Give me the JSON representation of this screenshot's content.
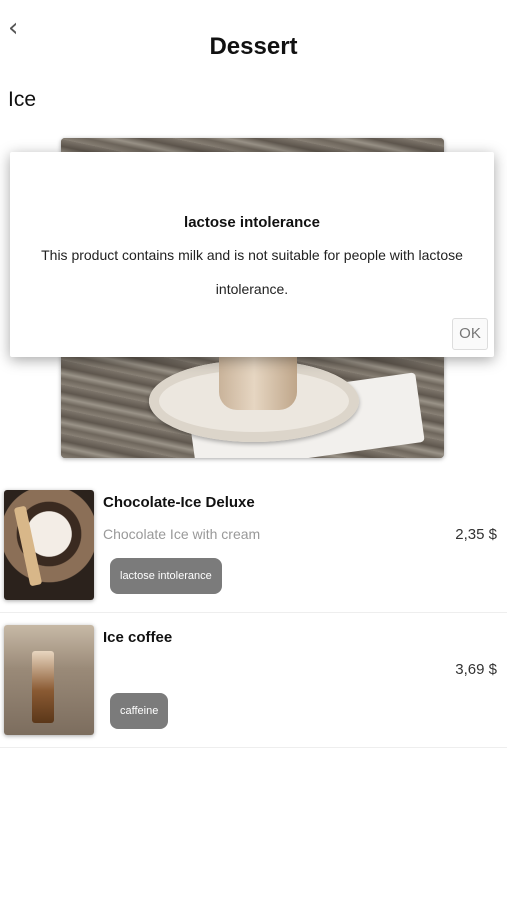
{
  "header": {
    "back_icon": "chevron-left-icon",
    "title": "Dessert"
  },
  "section": {
    "title": "Ice"
  },
  "dialog": {
    "title": "lactose intolerance",
    "message": "This product contains milk and is not suitable for people with lactose intolerance.",
    "ok_label": "OK"
  },
  "items": [
    {
      "name": "Chocolate-Ice Deluxe",
      "description": "Chocolate Ice with cream",
      "price": "2,35 $",
      "tag": "lactose intolerance"
    },
    {
      "name": "Ice coffee",
      "description": "",
      "price": "3,69 $",
      "tag": "caffeine"
    }
  ]
}
